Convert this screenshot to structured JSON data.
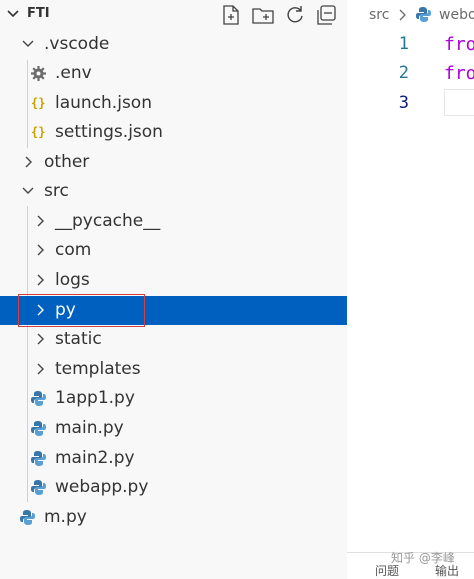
{
  "explorer": {
    "title": "FTI",
    "header_icons": [
      "new-file-icon",
      "new-folder-icon",
      "refresh-icon",
      "collapse-all-icon"
    ],
    "items": [
      {
        "label": ".vscode",
        "type": "folder",
        "expanded": true,
        "depth": 1
      },
      {
        "label": ".env",
        "type": "file",
        "icon": "gear-icon",
        "depth": 2
      },
      {
        "label": "launch.json",
        "type": "file",
        "icon": "json-icon",
        "depth": 2
      },
      {
        "label": "settings.json",
        "type": "file",
        "icon": "json-icon",
        "depth": 2
      },
      {
        "label": "other",
        "type": "folder",
        "expanded": false,
        "depth": 1
      },
      {
        "label": "src",
        "type": "folder",
        "expanded": true,
        "depth": 1
      },
      {
        "label": "__pycache__",
        "type": "folder",
        "expanded": false,
        "depth": 2
      },
      {
        "label": "com",
        "type": "folder",
        "expanded": false,
        "depth": 2
      },
      {
        "label": "logs",
        "type": "folder",
        "expanded": false,
        "depth": 2
      },
      {
        "label": "py",
        "type": "folder",
        "expanded": false,
        "depth": 2,
        "selected": true
      },
      {
        "label": "static",
        "type": "folder",
        "expanded": false,
        "depth": 2
      },
      {
        "label": "templates",
        "type": "folder",
        "expanded": false,
        "depth": 2
      },
      {
        "label": "1app1.py",
        "type": "file",
        "icon": "python-icon",
        "depth": 2
      },
      {
        "label": "main.py",
        "type": "file",
        "icon": "python-icon",
        "depth": 2
      },
      {
        "label": "main2.py",
        "type": "file",
        "icon": "python-icon",
        "depth": 2
      },
      {
        "label": "webapp.py",
        "type": "file",
        "icon": "python-icon",
        "depth": 2
      },
      {
        "label": "m.py",
        "type": "file",
        "icon": "python-icon",
        "depth": 1
      }
    ]
  },
  "editor": {
    "breadcrumb": {
      "folder": "src",
      "file": "webo"
    },
    "lines": [
      {
        "number": "1",
        "text": "fro"
      },
      {
        "number": "2",
        "text": "fro"
      },
      {
        "number": "3",
        "text": ""
      }
    ],
    "active_line": "3"
  },
  "panel": {
    "tabs": [
      "问题",
      "输出"
    ]
  },
  "watermark": "知乎 @李峰",
  "colors": {
    "selection": "#0060c0",
    "highlight_box": "#d04040",
    "keyword": "#af00db",
    "line_number": "#237893",
    "json_icon": "#c8a200",
    "python_blue": "#3776ab"
  }
}
